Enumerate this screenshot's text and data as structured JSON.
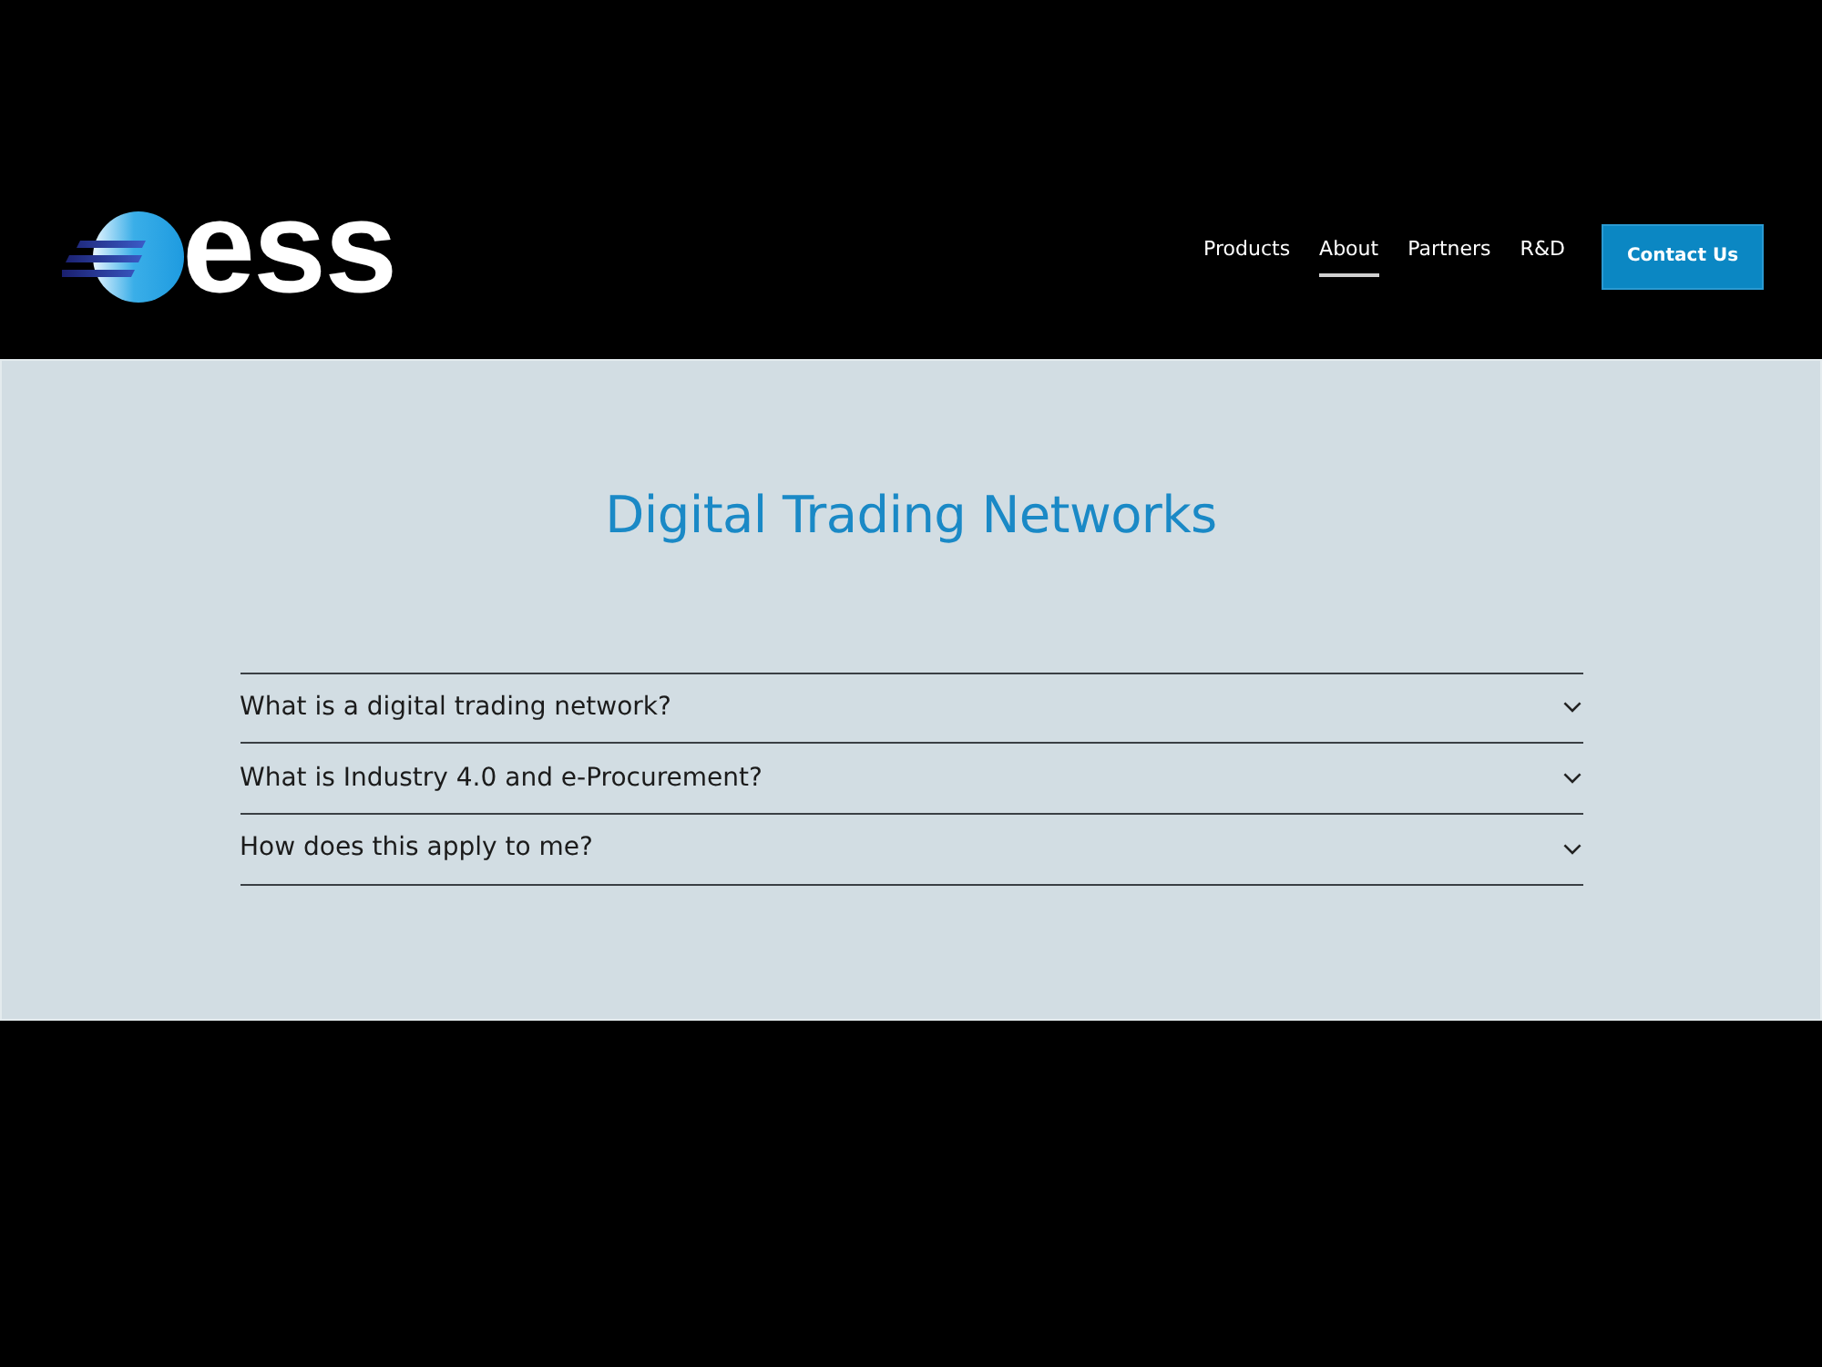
{
  "header": {
    "logo": {
      "text": "ess"
    },
    "nav": [
      {
        "label": "Products",
        "selected": false
      },
      {
        "label": "About",
        "selected": true
      },
      {
        "label": "Partners",
        "selected": false
      },
      {
        "label": "R&D",
        "selected": false
      }
    ],
    "cta": "Contact Us"
  },
  "section": {
    "title": "Digital Trading Networks",
    "faq": [
      {
        "question": "What is a digital trading network?",
        "expanded": false
      },
      {
        "question": "What is Industry 4.0 and e-Procurement?",
        "expanded": false
      },
      {
        "question": "How does this apply to me?",
        "expanded": false
      }
    ]
  }
}
